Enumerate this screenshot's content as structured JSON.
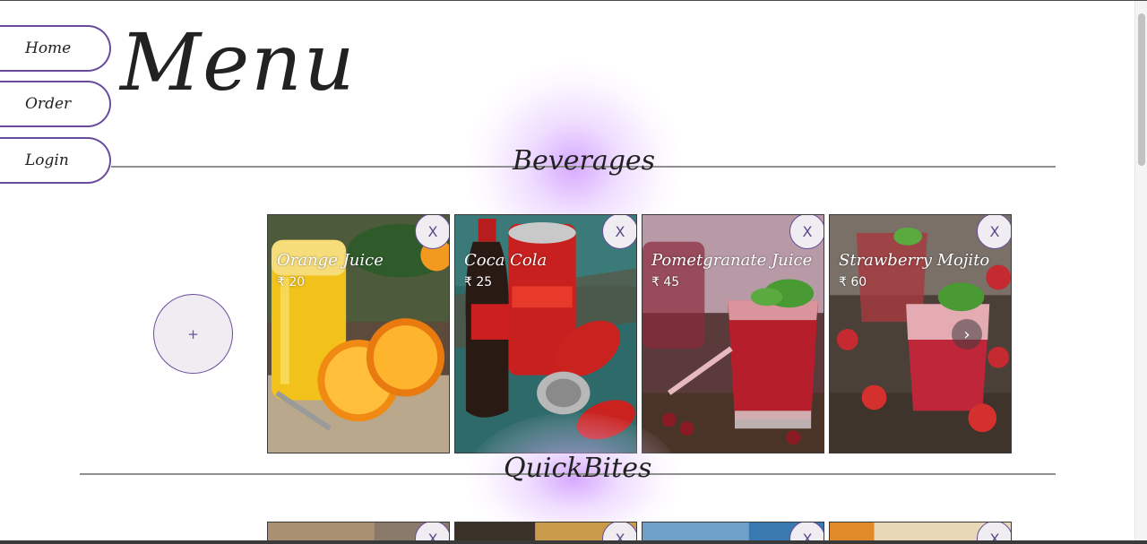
{
  "nav": {
    "home": "Home",
    "order": "Order",
    "login": "Login"
  },
  "page": {
    "title": "Menu",
    "accent_color": "#6a4c9c",
    "glow_color": "#c98cff"
  },
  "sections": [
    {
      "title": "Beverages",
      "add_label": "+",
      "items": [
        {
          "name": "Orange Juice",
          "price": "₹ 20",
          "close_label": "X"
        },
        {
          "name": "Coca Cola",
          "price": "₹ 25",
          "close_label": "X"
        },
        {
          "name": "Pometgranate Juice",
          "price": "₹ 45",
          "close_label": "X"
        },
        {
          "name": "Strawberry Mojito",
          "price": "₹ 60",
          "close_label": "X",
          "next_label": "›"
        }
      ]
    },
    {
      "title": "QuickBites",
      "items": [
        {
          "close_label": "X"
        },
        {
          "close_label": "X"
        },
        {
          "close_label": "X"
        },
        {
          "close_label": "X"
        }
      ]
    }
  ]
}
